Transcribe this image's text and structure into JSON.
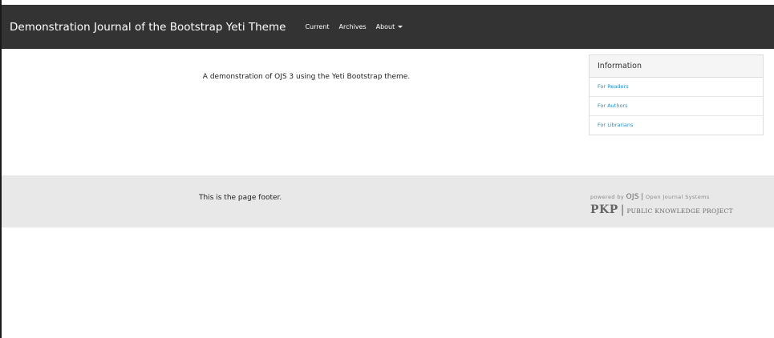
{
  "navbar": {
    "brand": "Demonstration Journal of the Bootstrap Yeti Theme",
    "items": [
      {
        "label": "Current"
      },
      {
        "label": "Archives"
      },
      {
        "label": "About"
      }
    ]
  },
  "main": {
    "description": "A demonstration of OJS 3 using the Yeti Bootstrap theme."
  },
  "sidebar": {
    "title": "Information",
    "links": [
      {
        "label": "For Readers"
      },
      {
        "label": "For Authors"
      },
      {
        "label": "For Librarians"
      }
    ]
  },
  "footer": {
    "text": "This is the page footer.",
    "powered_prefix": "powered by",
    "ojs": "OJS",
    "ojs_full": "Open Journal Systems",
    "pkp": "PKP",
    "pkp_full": "PUBLIC KNOWLEDGE PROJECT"
  },
  "colors": {
    "navbar_bg": "#333333",
    "link": "#2a8fbd",
    "footer_bg": "#e8e8e8"
  }
}
